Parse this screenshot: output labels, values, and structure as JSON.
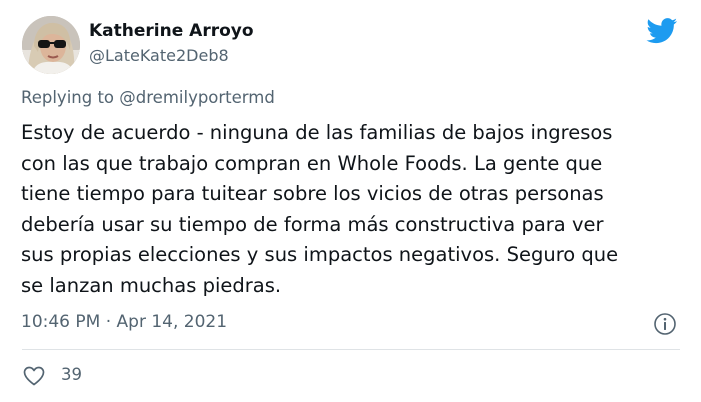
{
  "user": {
    "name": "Katherine Arroyo",
    "handle": "@LateKate2Deb8"
  },
  "reply": {
    "prefix": "Replying to ",
    "mention": "@dremilyportermd"
  },
  "tweet": {
    "lines": [
      "Estoy de acuerdo - ninguna de las familias de bajos ingresos",
      "con las que trabajo compran en Whole Foods. La gente que",
      "tiene tiempo para tuitear sobre los vicios de otras personas",
      "debería usar su tiempo de forma más constructiva para ver",
      "sus propias elecciones y sus impactos negativos. Seguro que",
      "se lanzan muchas piedras."
    ],
    "timestamp": "10:46 PM · Apr 14, 2021",
    "likes": "39"
  },
  "icons": {
    "brand": "twitter-bird-icon",
    "info": "info-icon",
    "like": "heart-icon"
  },
  "colors": {
    "brand": "#1d9bf0",
    "secondary_text": "#536471",
    "primary_text": "#0f1419",
    "divider": "#dfe3e6"
  }
}
